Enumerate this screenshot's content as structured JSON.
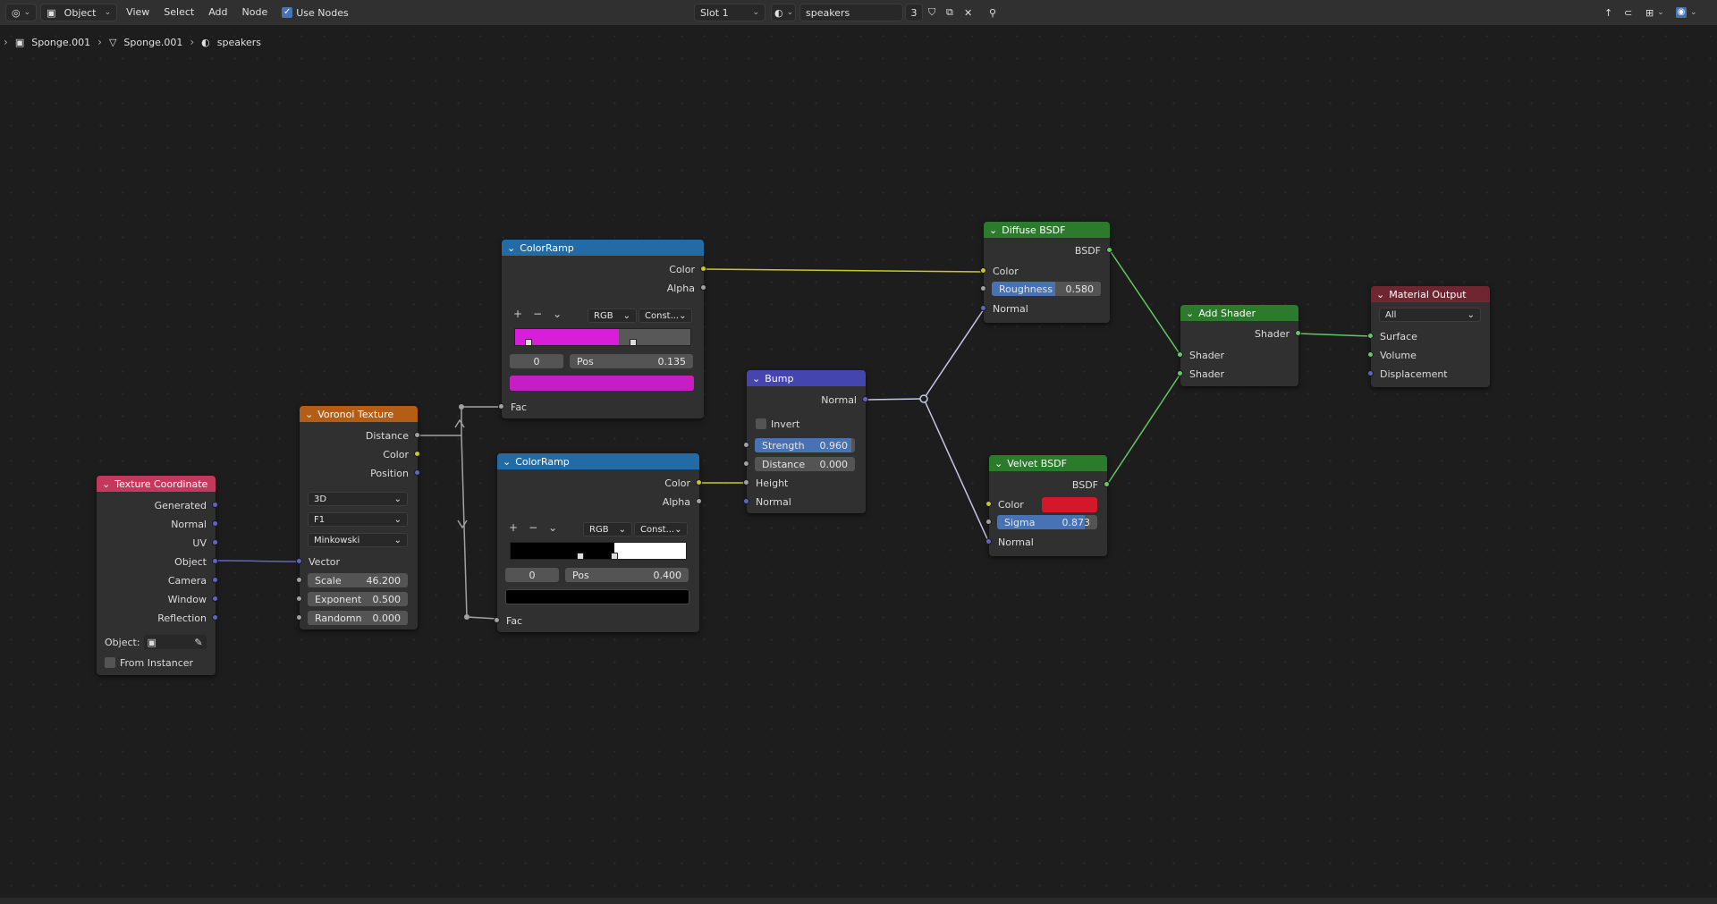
{
  "header": {
    "mode": "Object",
    "menus": [
      "View",
      "Select",
      "Add",
      "Node"
    ],
    "use_nodes_label": "Use Nodes",
    "slot": "Slot 1",
    "material_name": "speakers",
    "user_count": "3"
  },
  "breadcrumb": [
    "Sponge.001",
    "Sponge.001",
    "speakers"
  ],
  "nodes": {
    "texcoord": {
      "title": "Texture Coordinate",
      "outputs": [
        "Generated",
        "Normal",
        "UV",
        "Object",
        "Camera",
        "Window",
        "Reflection"
      ],
      "object_label": "Object:",
      "from_instancer": "From Instancer"
    },
    "voronoi": {
      "title": "Voronoi Texture",
      "outputs": [
        "Distance",
        "Color",
        "Position"
      ],
      "dim": "3D",
      "feature": "F1",
      "metric": "Minkowski",
      "input_vector": "Vector",
      "scale_label": "Scale",
      "scale_value": "46.200",
      "exponent_label": "Exponent",
      "exponent_value": "0.500",
      "random_label": "Randomn",
      "random_value": "0.000"
    },
    "ramp1": {
      "title": "ColorRamp",
      "out_color": "Color",
      "out_alpha": "Alpha",
      "mode": "RGB",
      "interp": "Const...",
      "index": "0",
      "pos_label": "Pos",
      "pos_value": "0.135",
      "input_fac": "Fac",
      "color_left": "#d81ed8",
      "color_right": "#585858",
      "swatch": "#c51ec5"
    },
    "ramp2": {
      "title": "ColorRamp",
      "out_color": "Color",
      "out_alpha": "Alpha",
      "mode": "RGB",
      "interp": "Const...",
      "index": "0",
      "pos_label": "Pos",
      "pos_value": "0.400",
      "input_fac": "Fac",
      "color_left": "#000000",
      "color_right": "#ffffff",
      "swatch": "#000000"
    },
    "bump": {
      "title": "Bump",
      "out_normal": "Normal",
      "invert": "Invert",
      "strength_label": "Strength",
      "strength_value": "0.960",
      "strength_fraction": 0.96,
      "distance_label": "Distance",
      "distance_value": "0.000",
      "in_height": "Height",
      "in_normal": "Normal"
    },
    "diffuse": {
      "title": "Diffuse BSDF",
      "out_bsdf": "BSDF",
      "in_color": "Color",
      "roughness_label": "Roughness",
      "roughness_value": "0.580",
      "roughness_fraction": 0.58,
      "in_normal": "Normal"
    },
    "velvet": {
      "title": "Velvet BSDF",
      "out_bsdf": "BSDF",
      "in_color": "Color",
      "color_value": "#d4182a",
      "sigma_label": "Sigma",
      "sigma_value": "0.873",
      "sigma_fraction": 0.873,
      "in_normal": "Normal"
    },
    "add": {
      "title": "Add Shader",
      "out_shader": "Shader",
      "in1": "Shader",
      "in2": "Shader"
    },
    "output": {
      "title": "Material Output",
      "target": "All",
      "in_surface": "Surface",
      "in_volume": "Volume",
      "in_displacement": "Displacement"
    }
  },
  "colors": {
    "texture_header": "#c4385e",
    "voronoi_header": "#b35d17",
    "converter_header": "#236ba4",
    "vector_header": "#4545b0",
    "shader_header": "#2c7a2c",
    "output_header": "#6f2631"
  }
}
